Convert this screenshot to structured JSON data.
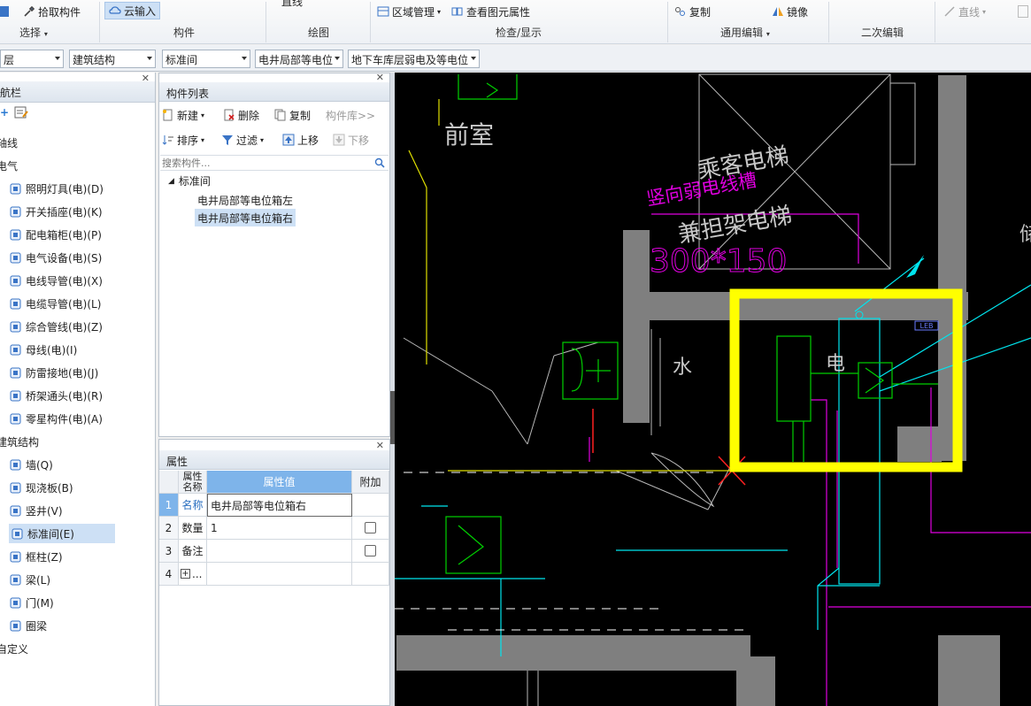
{
  "ribbon": {
    "pick_label": "拾取构件",
    "cloud_input_label": "云输入",
    "draw_top_label": "直线",
    "region_mgmt_label": "区域管理",
    "view_props_label": "查看图元属性",
    "copy_label": "复制",
    "mirror_label": "镜像",
    "line_label": "直线",
    "groups": {
      "select": "选择",
      "component": "构件",
      "draw": "绘图",
      "check_display": "检查/显示",
      "general_edit": "通用编辑",
      "secondary_edit": "二次编辑"
    }
  },
  "filters": {
    "floor": "层",
    "discipline": "建筑结构",
    "type": "标准间",
    "component": "电井局部等电位",
    "layer": "地下车库层弱电及等电位"
  },
  "nav": {
    "title": "导航栏",
    "title_visible": "航栏",
    "items": [
      {
        "label": "轴线"
      },
      {
        "label": "电气"
      },
      {
        "label": "照明灯具(电)(D)"
      },
      {
        "label": "开关插座(电)(K)"
      },
      {
        "label": "配电箱柜(电)(P)"
      },
      {
        "label": "电气设备(电)(S)"
      },
      {
        "label": "电线导管(电)(X)"
      },
      {
        "label": "电缆导管(电)(L)"
      },
      {
        "label": "综合管线(电)(Z)"
      },
      {
        "label": "母线(电)(I)"
      },
      {
        "label": "防雷接地(电)(J)"
      },
      {
        "label": "桥架通头(电)(R)"
      },
      {
        "label": "零星构件(电)(A)"
      },
      {
        "label": "建筑结构"
      },
      {
        "label": "墙(Q)"
      },
      {
        "label": "现浇板(B)"
      },
      {
        "label": "竖井(V)"
      },
      {
        "label": "标准间(E)"
      },
      {
        "label": "框柱(Z)"
      },
      {
        "label": "梁(L)"
      },
      {
        "label": "门(M)"
      },
      {
        "label": "圈梁"
      },
      {
        "label": "自定义"
      }
    ],
    "visible_labels": [
      "轴线",
      "电气",
      "照明灯具(电)(D)",
      "开关插座(电)(K)",
      "配电箱柜(电)(P)",
      "电气设备(电)(S)",
      "电线导管(电)(X)",
      "电缆导管(电)(L)",
      "综合管线(电)(Z)",
      "母线(电)(I)",
      "防雷接地(电)(J)",
      "桥架通头(电)(R)",
      "零星构件(电)(A)",
      "建筑结构",
      "墙(Q)",
      "现浇板(B)",
      "竖井(V)",
      "标准间(E)",
      "框柱(Z)",
      "梁(L)",
      "门(M)",
      "圈梁",
      "自定义"
    ]
  },
  "component_list": {
    "title": "构件列表",
    "new_label": "新建",
    "delete_label": "删除",
    "copy_label": "复制",
    "library_label": "构件库>>",
    "sort_label": "排序",
    "filter_label": "过滤",
    "up_label": "上移",
    "down_label": "下移",
    "search_placeholder": "搜索构件...",
    "root": "标准间",
    "children": [
      "电井局部等电位箱左",
      "电井局部等电位箱右"
    ],
    "selected": "电井局部等电位箱右"
  },
  "properties": {
    "title": "属性",
    "header_name": "属性名称",
    "header_name_line1": "属性",
    "header_name_line2": "名称",
    "header_value": "属性值",
    "header_extra": "附加",
    "rows": [
      {
        "num": "1",
        "name": "名称",
        "value": "电井局部等电位箱右",
        "checkbox": false
      },
      {
        "num": "2",
        "name": "数量",
        "value": "1",
        "checkbox": true
      },
      {
        "num": "3",
        "name": "备注",
        "value": "",
        "checkbox": true
      },
      {
        "num": "4",
        "name": "...",
        "value": "",
        "checkbox": false
      }
    ]
  },
  "drawing": {
    "texts": {
      "front_room": "前室",
      "vertical_cable": "竖向弱电线槽",
      "passenger_elevator": "乘客电梯",
      "fire_elevator": "兼担架电梯",
      "tray_size": "300*150",
      "water": "水",
      "electric": "电",
      "leb": "LEB",
      "edge_char": "储"
    },
    "colors": {
      "background": "#000000",
      "highlight": "#ffff00",
      "magenta": "#e000e0",
      "green": "#00d000",
      "cyan": "#00e5ee",
      "gray_wall": "#7f7f7f",
      "red": "#ff2020"
    }
  }
}
